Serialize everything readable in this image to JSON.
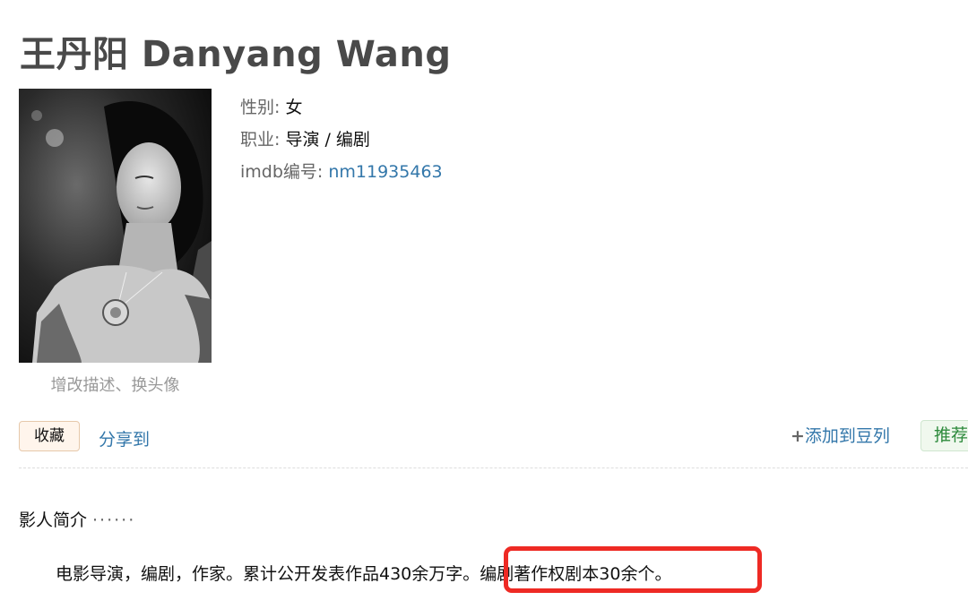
{
  "person": {
    "name": "王丹阳 Danyang Wang",
    "photo_edit_label": "增改描述、换头像"
  },
  "info": {
    "gender_label": "性别:",
    "gender_value": "女",
    "profession_label": "职业:",
    "profession_value": "导演 / 编剧",
    "imdb_label": "imdb编号:",
    "imdb_value": "nm11935463"
  },
  "actions": {
    "collect_label": "收藏",
    "share_label": "分享到",
    "add_doulist_plus": "+",
    "add_doulist_label": "添加到豆列",
    "recommend_label": "推荐"
  },
  "bio": {
    "section_title": "影人简介",
    "section_dots": "······",
    "intro_text": "电影导演，编剧，作家。累计公开发表作品430余万字。编剧著作权剧本30余个。"
  },
  "colors": {
    "link": "#3377aa",
    "highlight": "#ee2a24",
    "title": "#494949"
  }
}
